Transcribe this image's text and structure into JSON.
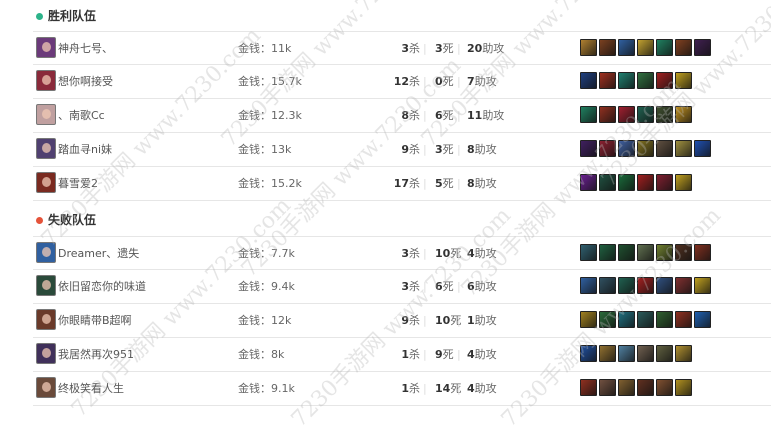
{
  "win_team": {
    "title": "胜利队伍",
    "color": "#2db38a",
    "players": [
      {
        "name": "神舟七号、",
        "gold": "金钱：11k",
        "kills": "3",
        "deaths": "3",
        "assists": "20",
        "avatar_color": "#6b3a7a",
        "items": [
          "#b08030",
          "#7a4020",
          "#3060a0",
          "#c0a030",
          "#208060",
          "#804020",
          "#402050"
        ]
      },
      {
        "name": "想你啊接受",
        "gold": "金钱：15.7k",
        "kills": "12",
        "deaths": "0",
        "assists": "7",
        "avatar_color": "#8a2a3a",
        "items": [
          "#204080",
          "#a03020",
          "#208070",
          "#307040",
          "#a02020",
          "#c0a020",
          ""
        ]
      },
      {
        "name": "、南歌Cc",
        "gold": "金钱：12.3k",
        "kills": "8",
        "deaths": "6",
        "assists": "11",
        "avatar_color": "#c0a0a0",
        "items": [
          "#208060",
          "#903020",
          "#a02030",
          "#206050",
          "#405030",
          "#c09020",
          ""
        ]
      },
      {
        "name": "踏血寻ni妹",
        "gold": "金钱：13k",
        "kills": "9",
        "deaths": "3",
        "assists": "8",
        "avatar_color": "#504070",
        "items": [
          "#402060",
          "#8a2030",
          "#4060a0",
          "#807020",
          "#605040",
          "#a09040",
          "#2050b0"
        ]
      },
      {
        "name": "暮雪爱2",
        "gold": "金钱：15.2k",
        "kills": "17",
        "deaths": "5",
        "assists": "8",
        "avatar_color": "#7a2a20",
        "items": [
          "#6a2090",
          "#205040",
          "#1a6a3a",
          "#a02020",
          "#802030",
          "#c0a020",
          ""
        ]
      }
    ]
  },
  "lose_team": {
    "title": "失败队伍",
    "color": "#e5533a",
    "players": [
      {
        "name": "Dreamer、遗失",
        "gold": "金钱：7.7k",
        "kills": "3",
        "deaths": "10",
        "assists": "4",
        "avatar_color": "#3060a0",
        "items": [
          "#306070",
          "#206040",
          "#205030",
          "#607050",
          "#708030",
          "#503020",
          "#803020"
        ]
      },
      {
        "name": "依旧留恋你的味道",
        "gold": "金钱：9.4k",
        "kills": "3",
        "deaths": "6",
        "assists": "6",
        "avatar_color": "#2a4a3a",
        "items": [
          "#3060a0",
          "#305060",
          "#206050",
          "#a02020",
          "#305080",
          "#803030",
          "#c0a020"
        ]
      },
      {
        "name": "你眼睛带B超啊",
        "gold": "金钱：12k",
        "kills": "9",
        "deaths": "10",
        "assists": "1",
        "avatar_color": "#6a3a2a",
        "items": [
          "#a08020",
          "#2a6a3a",
          "#207080",
          "#2a5a5a",
          "#306030",
          "#903020",
          "#2060b0"
        ]
      },
      {
        "name": "我居然再次951",
        "gold": "金钱：8k",
        "kills": "1",
        "deaths": "9",
        "assists": "4",
        "avatar_color": "#40305a",
        "items": [
          "#2050a0",
          "#907030",
          "#5080a0",
          "#706050",
          "#606040",
          "#b09030",
          ""
        ]
      },
      {
        "name": "终极笑看人生",
        "gold": "金钱：9.1k",
        "kills": "1",
        "deaths": "14",
        "assists": "4",
        "avatar_color": "#6a4a3a",
        "items": [
          "#903020",
          "#705040",
          "#806030",
          "#603020",
          "#805030",
          "#b09020",
          ""
        ]
      }
    ]
  },
  "labels": {
    "kill": "杀",
    "death": "死",
    "assist": "助攻",
    "sep": "|"
  },
  "watermark_text": "7230手游网 www.7230.com"
}
